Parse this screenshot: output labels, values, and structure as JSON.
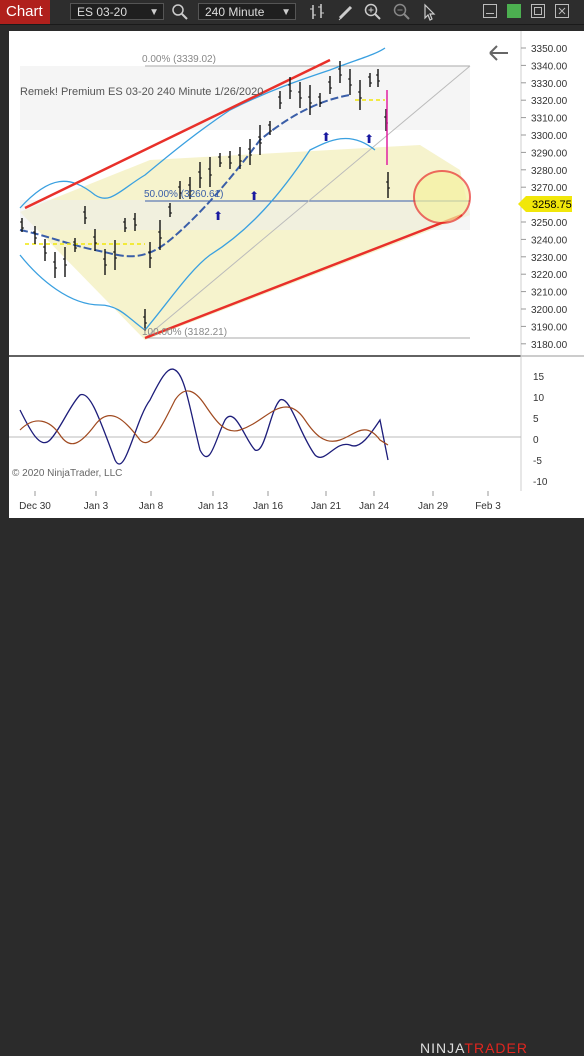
{
  "toolbar": {
    "chart_tab": "Chart",
    "instrument": "ES 03-20",
    "interval": "240 Minute",
    "icons": [
      "search-icon",
      "bar-type-icon",
      "drawing-tool-icon",
      "zoom-in-icon",
      "zoom-out-icon",
      "pointer-icon",
      "window-restore-icon",
      "maximize-icon",
      "close-icon"
    ]
  },
  "chart": {
    "label_line": "Remek!  Premium  ES 03-20  240 Minute  1/26/2020",
    "copyright": "© 2020 NinjaTrader, LLC",
    "fib_top": "0.00% (3339.02)",
    "fib_mid": "50.00% (3260.61)",
    "fib_bottom": "100.00% (3182.21)",
    "price_badge": "3258.75",
    "price_axis": [
      "3350.00",
      "3340.00",
      "3330.00",
      "3320.00",
      "3310.00",
      "3300.00",
      "3290.00",
      "3280.00",
      "3270.00",
      "3260.00",
      "3250.00",
      "3240.00",
      "3230.00",
      "3220.00",
      "3210.00",
      "3200.00",
      "3190.00",
      "3180.00"
    ],
    "osc_axis": [
      "15",
      "10",
      "5",
      "0",
      "-5",
      "-10"
    ],
    "date_axis": [
      "Dec 30",
      "Jan 3",
      "Jan 8",
      "Jan 13",
      "Jan 16",
      "Jan 21",
      "Jan 24",
      "Jan 29",
      "Feb 3"
    ],
    "colors": {
      "background": "#ffffff",
      "channel": "#e8302a",
      "bands": "#3aa0e0",
      "midline": "#3a5ea8",
      "osc_fast": "#1d1d7a",
      "osc_slow": "#a04a20",
      "badge": "#f1e70a",
      "fill": "#f5f2c8"
    }
  },
  "brand": {
    "prefix": "NINJA",
    "suffix": "TRADER"
  }
}
